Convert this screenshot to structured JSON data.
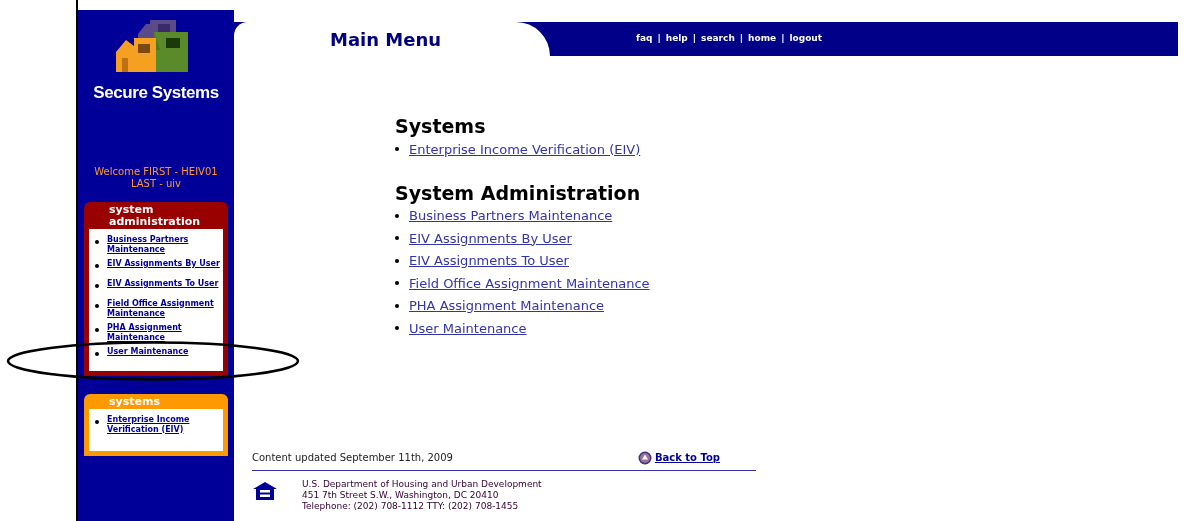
{
  "header": {
    "title": "Main Menu",
    "separator": "|",
    "nav_links": [
      "faq",
      "help",
      "search",
      "home",
      "logout"
    ]
  },
  "sidebar": {
    "logo_text": "Secure Systems",
    "welcome": "Welcome FIRST - HEIV01 LAST - uiv",
    "panels": [
      {
        "kind": "admin",
        "title": "system administration",
        "links": [
          "Business Partners Maintenance",
          "EIV Assignments By User",
          "EIV Assignments To User",
          "Field Office Assignment Maintenance",
          "PHA Assignment Maintenance",
          "User Maintenance"
        ]
      },
      {
        "kind": "systems",
        "title": "systems",
        "links": [
          "Enterprise Income Verification (EIV)"
        ]
      }
    ]
  },
  "sections": [
    {
      "heading": "Systems",
      "links": [
        "Enterprise Income Verification (EIV)"
      ]
    },
    {
      "heading": "System Administration",
      "links": [
        "Business Partners Maintenance",
        "EIV Assignments By User",
        "EIV Assignments To User",
        "Field Office Assignment Maintenance",
        "PHA Assignment Maintenance",
        "User Maintenance"
      ]
    }
  ],
  "footer": {
    "updated": "Content updated September 11th, 2009",
    "back_to_top": "Back to Top",
    "address_lines": [
      "U.S. Department of Housing and Urban Development",
      "451 7th Street S.W., Washington, DC 20410",
      "Telephone: (202) 708-1112 TTY: (202) 708-1455"
    ]
  }
}
